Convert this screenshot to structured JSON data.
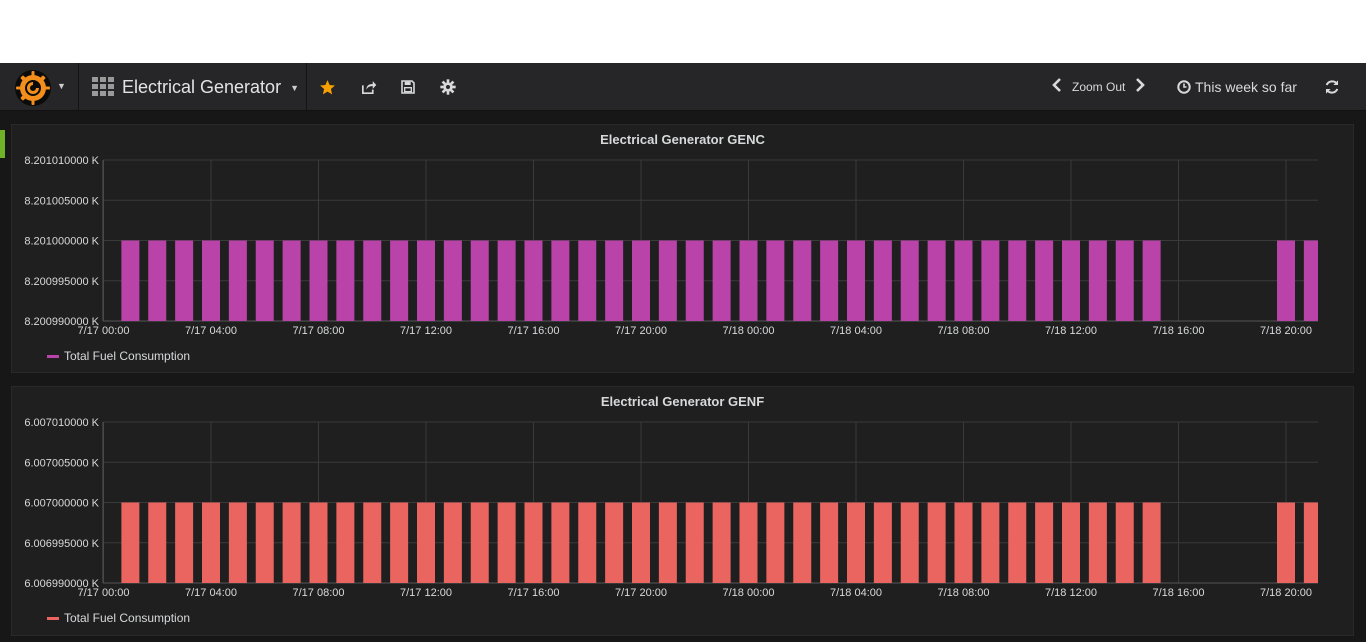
{
  "colors": {
    "navbar_bg": "#262628",
    "panel_bg": "#1f1f20",
    "accent_star": "#f7a000",
    "series_genc": "#ba43a9",
    "series_genf": "#ea6460",
    "row_marker": "#6fb228"
  },
  "navbar": {
    "logo_icon": "grafana-logo",
    "dashboard_title": "Electrical Generator",
    "icons": [
      "star-icon",
      "share-icon",
      "save-icon",
      "gear-icon"
    ],
    "zoom_out_label": "Zoom Out",
    "time_range": "This week so far",
    "refresh_icon": "refresh-icon"
  },
  "panels": [
    {
      "title": "Electrical Generator GENC",
      "legend": "Total Fuel Consumption"
    },
    {
      "title": "Electrical Generator GENF",
      "legend": "Total Fuel Consumption"
    }
  ],
  "chart_data": [
    {
      "type": "bar",
      "title": "Electrical Generator GENC",
      "x_tick_labels": [
        "7/17 00:00",
        "7/17 04:00",
        "7/17 08:00",
        "7/17 12:00",
        "7/17 16:00",
        "7/17 20:00",
        "7/18 00:00",
        "7/18 04:00",
        "7/18 08:00",
        "7/18 12:00",
        "7/18 16:00",
        "7/18 20:00"
      ],
      "y_tick_labels": [
        "8.200990000 K",
        "8.200995000 K",
        "8.201000000 K",
        "8.201005000 K",
        "8.201010000 K"
      ],
      "ylim": [
        8.20099,
        8.20101
      ],
      "y_unit": "K",
      "x_start": "7/17 00:00",
      "x_interval_hours": 1,
      "series": [
        {
          "name": "Total Fuel Consumption",
          "color": "#ba43a9",
          "x_hours": [
            1,
            2,
            3,
            4,
            5,
            6,
            7,
            8,
            9,
            10,
            11,
            12,
            13,
            14,
            15,
            16,
            17,
            18,
            19,
            20,
            21,
            22,
            23,
            24,
            25,
            26,
            27,
            28,
            29,
            30,
            31,
            32,
            33,
            34,
            35,
            36,
            37,
            38,
            39,
            44,
            45
          ],
          "values": [
            8.201,
            8.201,
            8.201,
            8.201,
            8.201,
            8.201,
            8.201,
            8.201,
            8.201,
            8.201,
            8.201,
            8.201,
            8.201,
            8.201,
            8.201,
            8.201,
            8.201,
            8.201,
            8.201,
            8.201,
            8.201,
            8.201,
            8.201,
            8.201,
            8.201,
            8.201,
            8.201,
            8.201,
            8.201,
            8.201,
            8.201,
            8.201,
            8.201,
            8.201,
            8.201,
            8.201,
            8.201,
            8.201,
            8.201,
            8.201,
            8.201
          ]
        }
      ],
      "grid": true,
      "legend_position": "bottom-left"
    },
    {
      "type": "bar",
      "title": "Electrical Generator GENF",
      "x_tick_labels": [
        "7/17 00:00",
        "7/17 04:00",
        "7/17 08:00",
        "7/17 12:00",
        "7/17 16:00",
        "7/17 20:00",
        "7/18 00:00",
        "7/18 04:00",
        "7/18 08:00",
        "7/18 12:00",
        "7/18 16:00",
        "7/18 20:00"
      ],
      "y_tick_labels": [
        "6.006990000 K",
        "6.006995000 K",
        "6.007000000 K",
        "6.007005000 K",
        "6.007010000 K"
      ],
      "ylim": [
        6.00699,
        6.00701
      ],
      "y_unit": "K",
      "x_start": "7/17 00:00",
      "x_interval_hours": 1,
      "series": [
        {
          "name": "Total Fuel Consumption",
          "color": "#ea6460",
          "x_hours": [
            1,
            2,
            3,
            4,
            5,
            6,
            7,
            8,
            9,
            10,
            11,
            12,
            13,
            14,
            15,
            16,
            17,
            18,
            19,
            20,
            21,
            22,
            23,
            24,
            25,
            26,
            27,
            28,
            29,
            30,
            31,
            32,
            33,
            34,
            35,
            36,
            37,
            38,
            39,
            44,
            45
          ],
          "values": [
            6.007,
            6.007,
            6.007,
            6.007,
            6.007,
            6.007,
            6.007,
            6.007,
            6.007,
            6.007,
            6.007,
            6.007,
            6.007,
            6.007,
            6.007,
            6.007,
            6.007,
            6.007,
            6.007,
            6.007,
            6.007,
            6.007,
            6.007,
            6.007,
            6.007,
            6.007,
            6.007,
            6.007,
            6.007,
            6.007,
            6.007,
            6.007,
            6.007,
            6.007,
            6.007,
            6.007,
            6.007,
            6.007,
            6.007,
            6.007,
            6.007
          ]
        }
      ],
      "grid": true,
      "legend_position": "bottom-left"
    }
  ]
}
